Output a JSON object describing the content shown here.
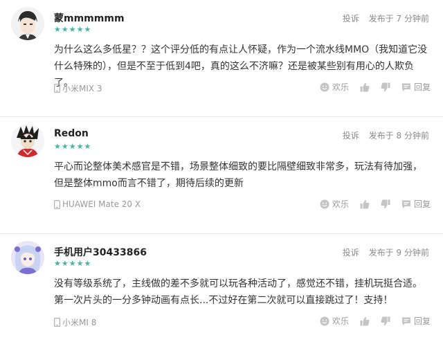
{
  "reviews": [
    {
      "username": "蒙mmmmmm",
      "rating": 5,
      "report_label": "投诉",
      "posted": "发布于 7 分钟前",
      "content": "为什么这么多低星？？这个评分低的有点让人怀疑，作为一个流水线MMO（我知道它没什么特殊的），但是不至于低到4吧，真的这么不济嘛？还是被某些别有用心的人欺负了。",
      "device": "小米MIX 3",
      "funny_label": "欢乐",
      "reply_label": "回复",
      "avatar_color": "#2b2b2b"
    },
    {
      "username": "Redon",
      "rating": 5,
      "report_label": "投诉",
      "posted": "发布于 8 分钟前",
      "content": "平心而论整体美术感官是不错，场景整体细致的要比隔壁细致非常多，玩法有待加强，但是整体mmo而言不错了，期待后续的更新",
      "device": "HUAWEI Mate 20 X",
      "funny_label": "欢乐",
      "reply_label": "回复",
      "avatar_color": "#d42a2a"
    },
    {
      "username": "手机用户30433866",
      "rating": 5,
      "report_label": "投诉",
      "posted": "发布于 9 分钟前",
      "content": "没有等级系统了，主线做的差不多就可以玩各种活动了，感觉还不错，挂机玩挺合适。第一次片头的一分多钟动画有点长...不过好在第二次就可以直接跳过了！支持！",
      "device": "小米MI 8",
      "funny_label": "欢乐",
      "reply_label": "回复",
      "avatar_color": "#7a6fd0"
    }
  ],
  "star_color": "#3cb8a6",
  "icons": {
    "device": "phone-icon",
    "funny": "smiley-icon",
    "like": "thumbs-up-icon",
    "dislike": "thumbs-down-icon",
    "reply": "chat-bubble-icon"
  }
}
